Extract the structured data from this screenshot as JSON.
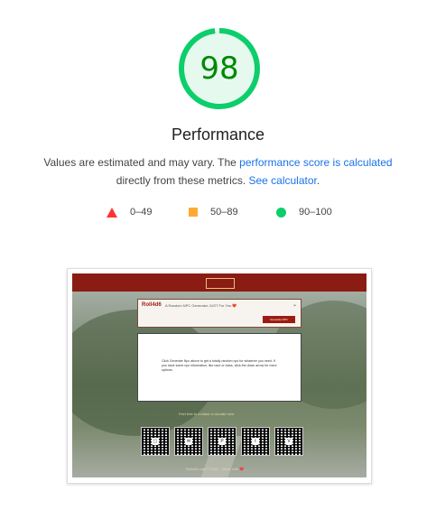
{
  "performance": {
    "score": "98",
    "title": "Performance",
    "desc_part1": "Values are estimated and may vary. The ",
    "desc_link1": "performance score is calculated",
    "desc_part2": "directly from these metrics. ",
    "desc_link2": "See calculator",
    "desc_end": "."
  },
  "legend": {
    "fail": "0–49",
    "average": "50–89",
    "pass": "90–100"
  },
  "colors": {
    "pass": "#0cce6b",
    "average": "#ffaa33",
    "fail": "#ff3333",
    "score_text": "#008800"
  },
  "screenshot": {
    "brand": "Roll4d6",
    "tagline": "A Random NPC Generator JUST For You ❤️",
    "generate_button": "Generate NPC",
    "instructions": "Click Generate Npc above to get a totally random npc for whatever you need. If you have some npc information, like race or class, click the down arrow for more options.",
    "footer_title": "Feel free to contact or donate here",
    "copyright": "Roll4d6.com © 2022 · Made with ❤️",
    "qr_icons": [
      "discord-icon",
      "email-icon",
      "paypal-icon",
      "twitter-icon",
      "venmo-icon"
    ]
  }
}
